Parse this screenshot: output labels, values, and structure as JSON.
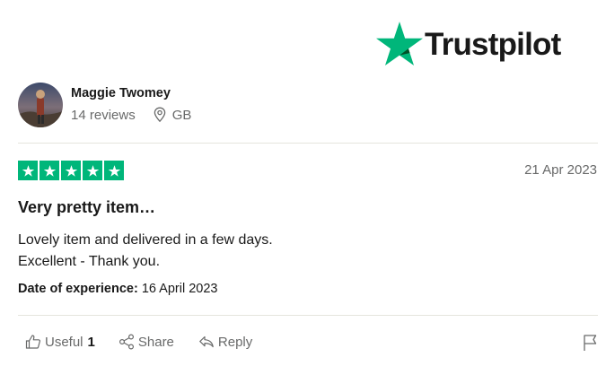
{
  "brand": {
    "name": "Trustpilot",
    "color": "#00b67a",
    "icon": "star-icon"
  },
  "reviewer": {
    "name": "Maggie Twomey",
    "reviews": "14 reviews",
    "country": "GB",
    "avatar": "avatar-photo"
  },
  "review": {
    "rating": 5,
    "rating_max": 5,
    "date": "21 Apr 2023",
    "title": "Very pretty item…",
    "body_lines": [
      "Lovely item and delivered in a few days.",
      "Excellent - Thank you."
    ],
    "experience_label": "Date of experience:",
    "experience_date": "16 April 2023"
  },
  "actions": {
    "useful_label": "Useful",
    "useful_count": "1",
    "share_label": "Share",
    "reply_label": "Reply",
    "icons": [
      "thumbs-up-icon",
      "share-icon",
      "reply-icon",
      "flag-icon"
    ]
  }
}
